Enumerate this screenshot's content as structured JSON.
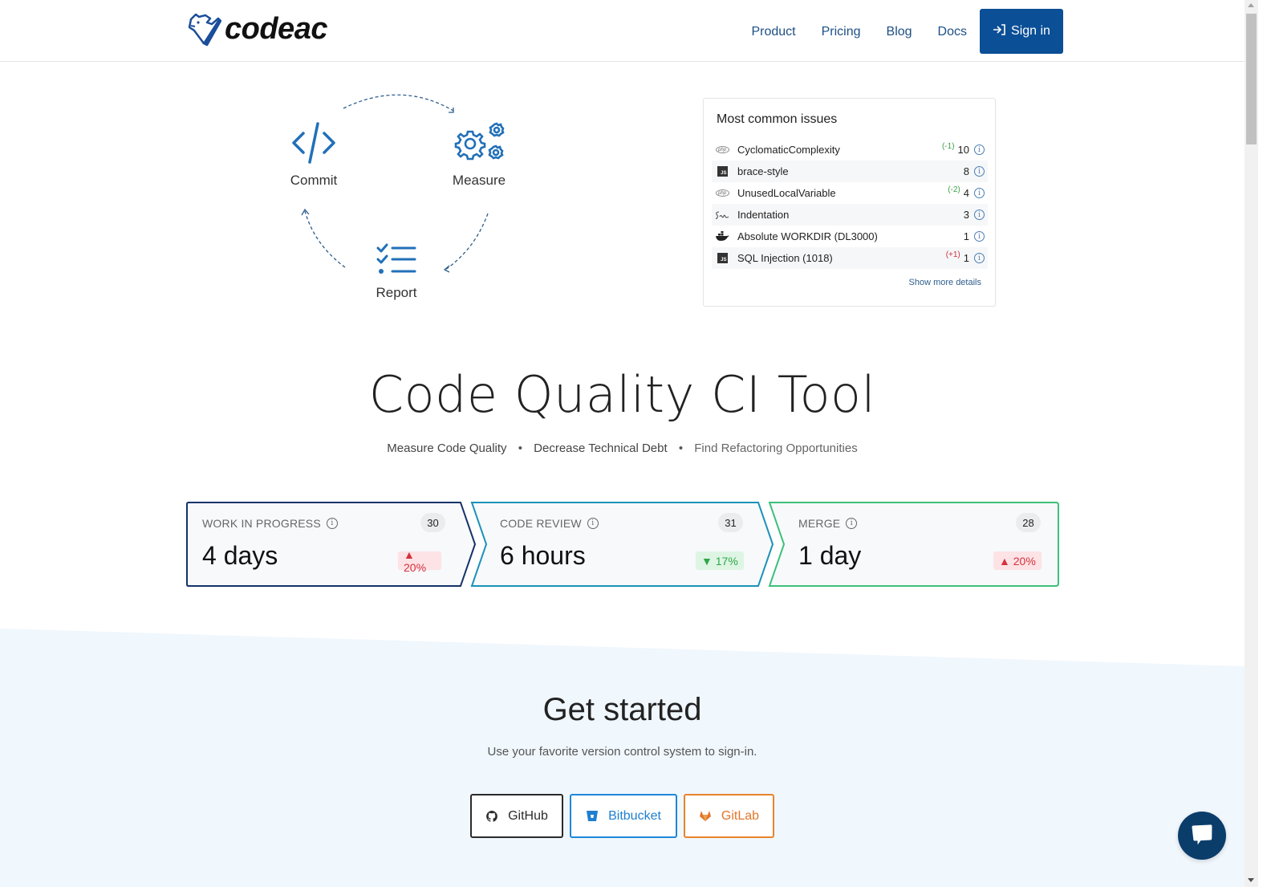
{
  "header": {
    "logo_text": "codeac",
    "nav": [
      {
        "label": "Product"
      },
      {
        "label": "Pricing"
      },
      {
        "label": "Blog"
      },
      {
        "label": "Docs"
      }
    ],
    "signin_label": "Sign in",
    "signin_icon": "sign-in-icon",
    "brand_color": "#0b4f96"
  },
  "cycle": {
    "steps": [
      {
        "label": "Commit",
        "icon": "code-icon"
      },
      {
        "label": "Measure",
        "icon": "gears-icon"
      },
      {
        "label": "Report",
        "icon": "checklist-icon"
      }
    ]
  },
  "issues": {
    "title": "Most common issues",
    "rows": [
      {
        "lang": "php",
        "name": "CyclomaticComplexity",
        "delta": "(-1)",
        "delta_type": "good",
        "count": "10"
      },
      {
        "lang": "js",
        "name": "brace-style",
        "delta": "",
        "delta_type": "",
        "count": "8"
      },
      {
        "lang": "php",
        "name": "UnusedLocalVariable",
        "delta": "(-2)",
        "delta_type": "good",
        "count": "4"
      },
      {
        "lang": "sass",
        "name": "Indentation",
        "delta": "",
        "delta_type": "",
        "count": "3"
      },
      {
        "lang": "docker",
        "name": "Absolute WORKDIR (DL3000)",
        "delta": "",
        "delta_type": "",
        "count": "1"
      },
      {
        "lang": "js",
        "name": "SQL Injection (1018)",
        "delta": "(+1)",
        "delta_type": "bad",
        "count": "1"
      }
    ],
    "show_more": "Show more details"
  },
  "hero": {
    "title": "Code Quality CI Tool",
    "taglines": [
      "Measure Code Quality",
      "Decrease Technical Debt",
      "Find Refactoring Opportunities"
    ],
    "separator": "•"
  },
  "pipeline": {
    "stages": [
      {
        "title": "WORK IN PROGRESS",
        "count": "30",
        "value": "4 days",
        "change": "▲ 20%",
        "trend": "up",
        "color": "#15326b"
      },
      {
        "title": "CODE REVIEW",
        "count": "31",
        "value": "6 hours",
        "change": "▼ 17%",
        "trend": "down",
        "color": "#1b92b8"
      },
      {
        "title": "MERGE",
        "count": "28",
        "value": "1 day",
        "change": "▲ 20%",
        "trend": "up",
        "color": "#3cc07a"
      }
    ]
  },
  "get_started": {
    "title": "Get started",
    "subtitle": "Use your favorite version control system to sign-in.",
    "buttons": [
      {
        "label": "GitHub",
        "icon": "github-icon",
        "color": "#2b2b2b"
      },
      {
        "label": "Bitbucket",
        "icon": "bitbucket-icon",
        "color": "#1e7fd0"
      },
      {
        "label": "GitLab",
        "icon": "gitlab-icon",
        "color": "#e2762a"
      }
    ]
  },
  "chat": {
    "icon": "chat-bubble-icon"
  }
}
